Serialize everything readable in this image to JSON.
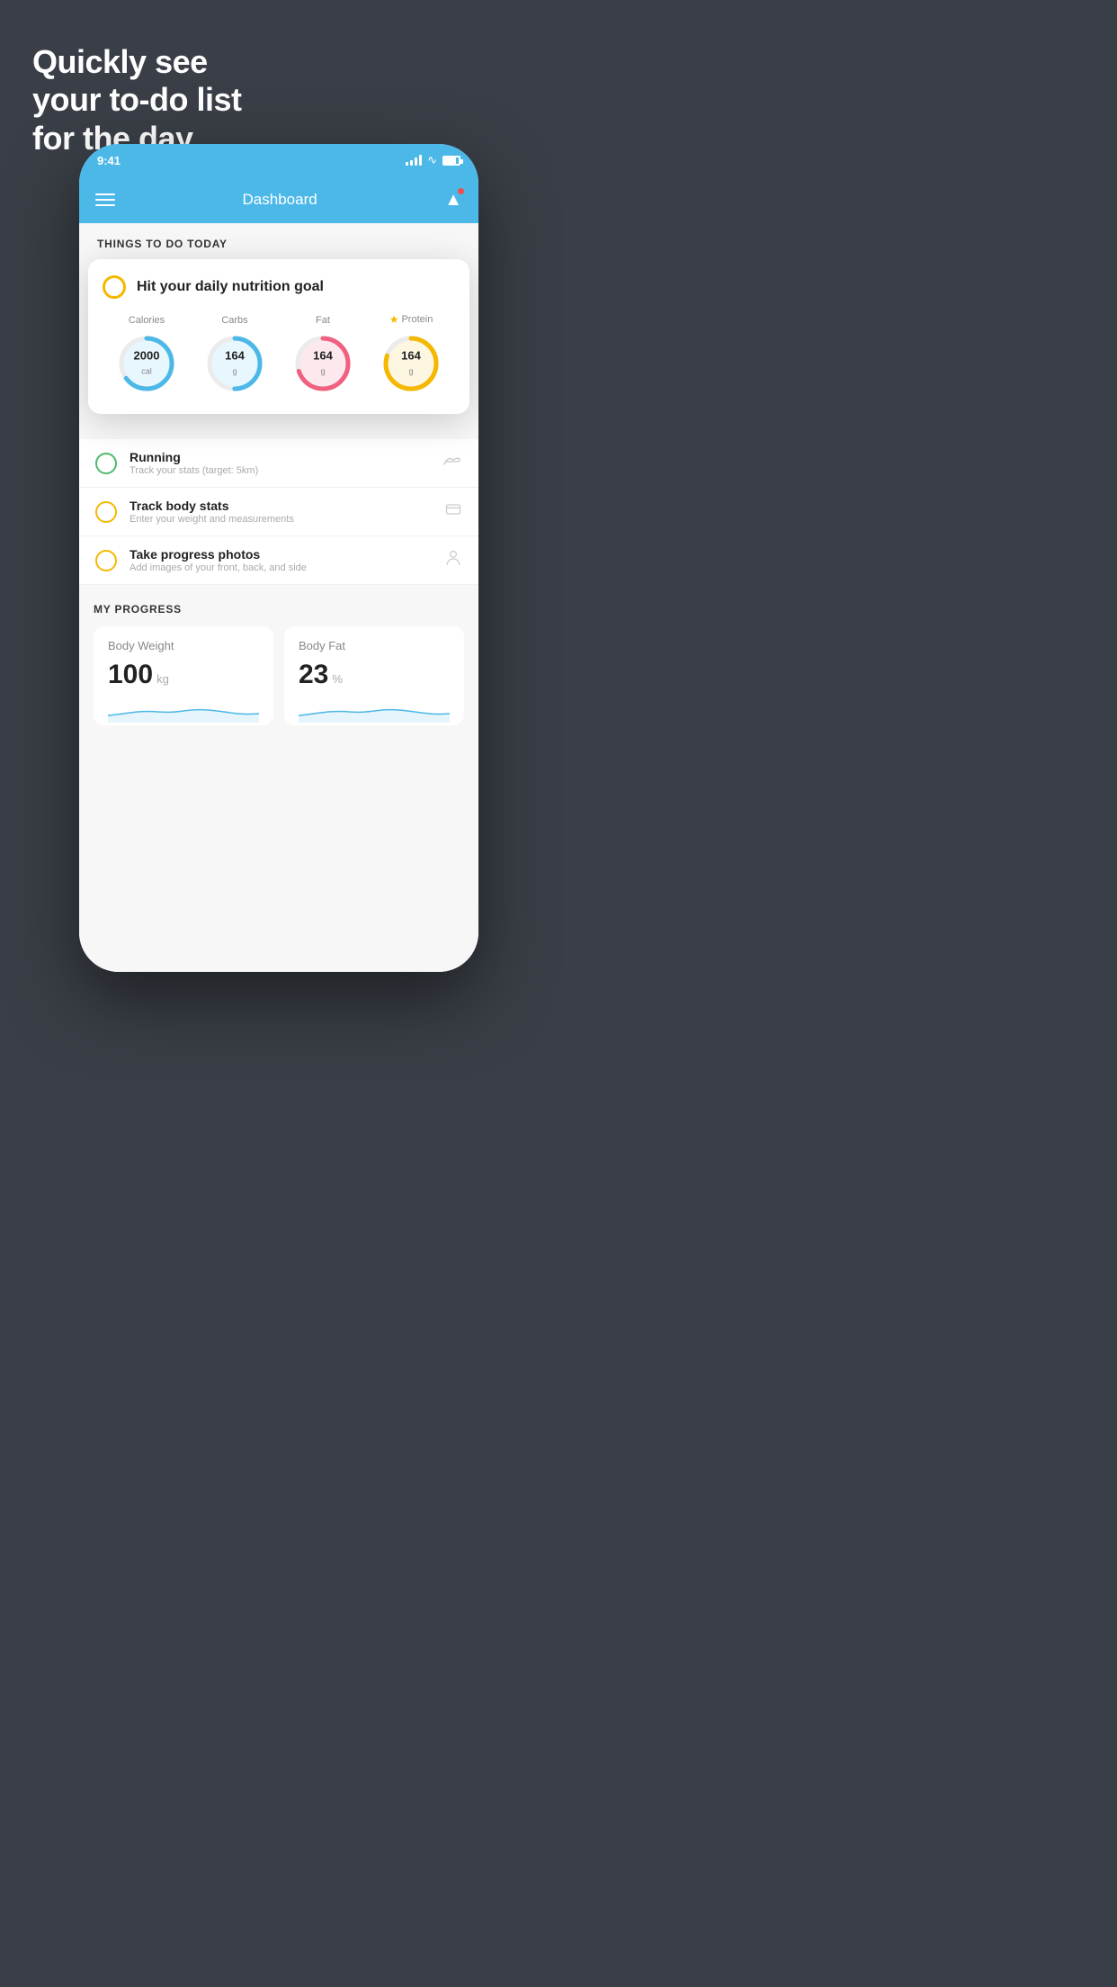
{
  "hero": {
    "line1": "Quickly see",
    "line2": "your to-do list",
    "line3": "for the day."
  },
  "status_bar": {
    "time": "9:41"
  },
  "header": {
    "title": "Dashboard"
  },
  "things_section": {
    "title": "THINGS TO DO TODAY"
  },
  "popup": {
    "indicator_color": "#f5b800",
    "title": "Hit your daily nutrition goal",
    "nutrition": [
      {
        "label": "Calories",
        "value": "2000",
        "unit": "cal",
        "color": "#4cb8e8",
        "bg_color": "#e8f6fd",
        "percent": 65
      },
      {
        "label": "Carbs",
        "value": "164",
        "unit": "g",
        "color": "#4cb8e8",
        "bg_color": "#e8f6fd",
        "percent": 50
      },
      {
        "label": "Fat",
        "value": "164",
        "unit": "g",
        "color": "#f06080",
        "bg_color": "#fde8ed",
        "percent": 70
      },
      {
        "label": "Protein",
        "value": "164",
        "unit": "g",
        "color": "#f5b800",
        "bg_color": "#fdf6e0",
        "percent": 80,
        "star": true
      }
    ]
  },
  "todo_items": [
    {
      "circle_color": "green",
      "main": "Running",
      "sub": "Track your stats (target: 5km)",
      "icon": "👟"
    },
    {
      "circle_color": "yellow",
      "main": "Track body stats",
      "sub": "Enter your weight and measurements",
      "icon": "⊡"
    },
    {
      "circle_color": "yellow",
      "main": "Take progress photos",
      "sub": "Add images of your front, back, and side",
      "icon": "👤"
    }
  ],
  "progress": {
    "section_title": "MY PROGRESS",
    "cards": [
      {
        "title": "Body Weight",
        "value": "100",
        "unit": "kg"
      },
      {
        "title": "Body Fat",
        "value": "23",
        "unit": "%"
      }
    ]
  }
}
